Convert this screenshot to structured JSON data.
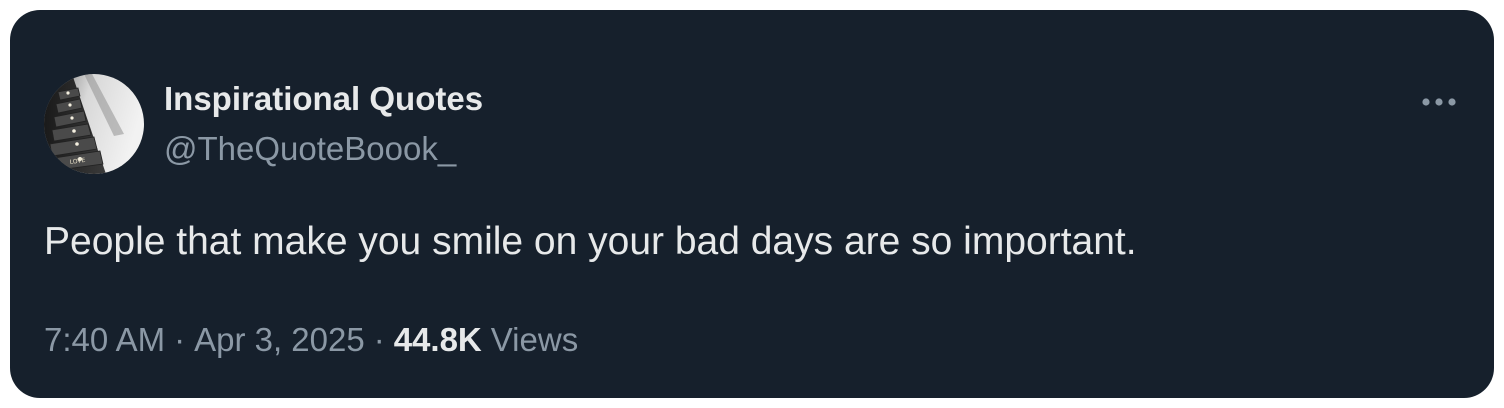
{
  "tweet": {
    "author": {
      "display_name": "Inspirational Quotes",
      "handle": "@TheQuoteBoook_",
      "avatar_icon": "avatar-stairs-photo",
      "avatar_text": "LOVE"
    },
    "text": "People that make you smile on your bad days are so important.",
    "meta": {
      "time": "7:40 AM",
      "separator": "·",
      "date": "Apr 3, 2025",
      "views_count": "44.8K",
      "views_label": "Views"
    },
    "more_icon": "more-horizontal-icon"
  },
  "colors": {
    "background": "#16202c",
    "primary_text": "#e7e9ea",
    "secondary_text": "#8b98a5"
  }
}
